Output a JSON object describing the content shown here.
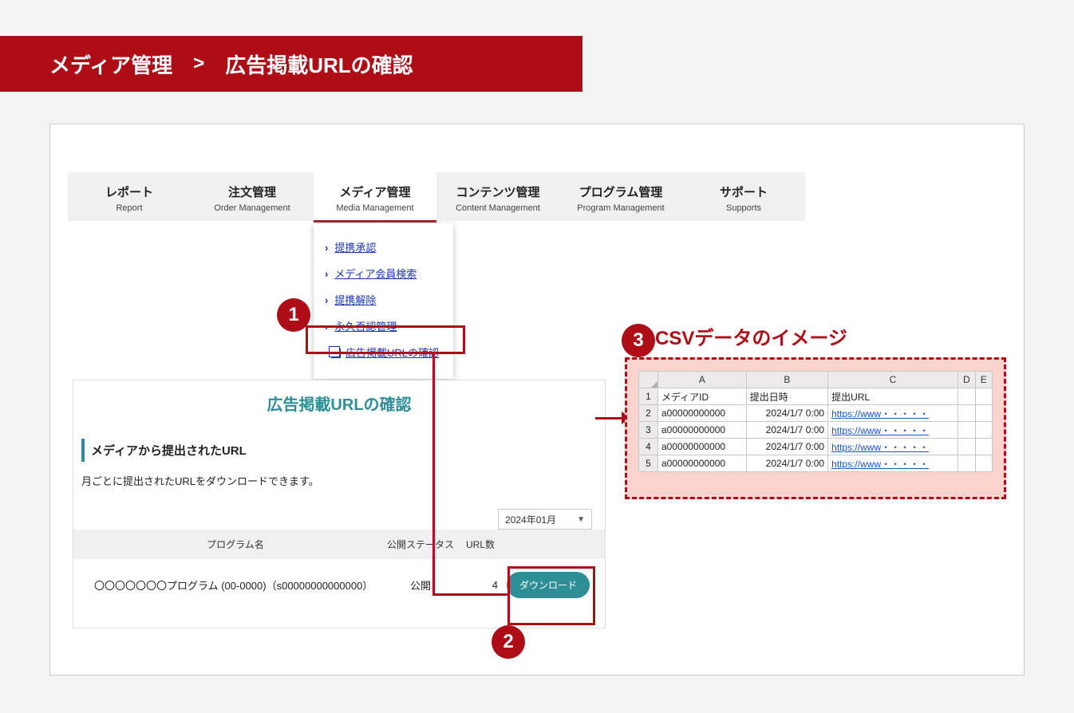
{
  "hero": {
    "crumb1": "メディア管理",
    "arrow": ">",
    "crumb2": "広告掲載URLの確認"
  },
  "nav": {
    "items": [
      {
        "ja": "レポート",
        "en": "Report"
      },
      {
        "ja": "注文管理",
        "en": "Order Management"
      },
      {
        "ja": "メディア管理",
        "en": "Media Management"
      },
      {
        "ja": "コンテンツ管理",
        "en": "Content Management"
      },
      {
        "ja": "プログラム管理",
        "en": "Program Management"
      },
      {
        "ja": "サポート",
        "en": "Supports"
      }
    ]
  },
  "dropdown": {
    "items": [
      "提携承認",
      "メディア会員検索",
      "提携解除",
      "永久否認管理",
      "広告掲載URLの確認"
    ]
  },
  "lower": {
    "title": "広告掲載URLの確認",
    "subhead": "メディアから提出されたURL",
    "desc": "月ごとに提出されたURLをダウンロードできます。",
    "month": "2024年01月",
    "th_program": "プログラム名",
    "th_status": "公開ステータス",
    "th_url": "URL数",
    "row": {
      "name": "〇〇〇〇〇〇〇プログラム (00-0000)（s00000000000000）",
      "status": "公開",
      "urlcount": "4",
      "button": "ダウンロード"
    }
  },
  "csv": {
    "caption": "CSVデータのイメージ",
    "cols": [
      "A",
      "B",
      "C",
      "D",
      "E"
    ],
    "header": [
      "メディアID",
      "提出日時",
      "提出URL",
      "",
      ""
    ],
    "rows": [
      {
        "n": "2",
        "a": "a00000000000",
        "b": "2024/1/7 0:00",
        "c": "https://www・・・・・"
      },
      {
        "n": "3",
        "a": "a00000000000",
        "b": "2024/1/7 0:00",
        "c": "https://www・・・・・"
      },
      {
        "n": "4",
        "a": "a00000000000",
        "b": "2024/1/7 0:00",
        "c": "https://www・・・・・"
      },
      {
        "n": "5",
        "a": "a00000000000",
        "b": "2024/1/7 0:00",
        "c": "https://www・・・・・"
      }
    ]
  },
  "bullets": {
    "b1": "1",
    "b2": "2",
    "b3": "3"
  }
}
